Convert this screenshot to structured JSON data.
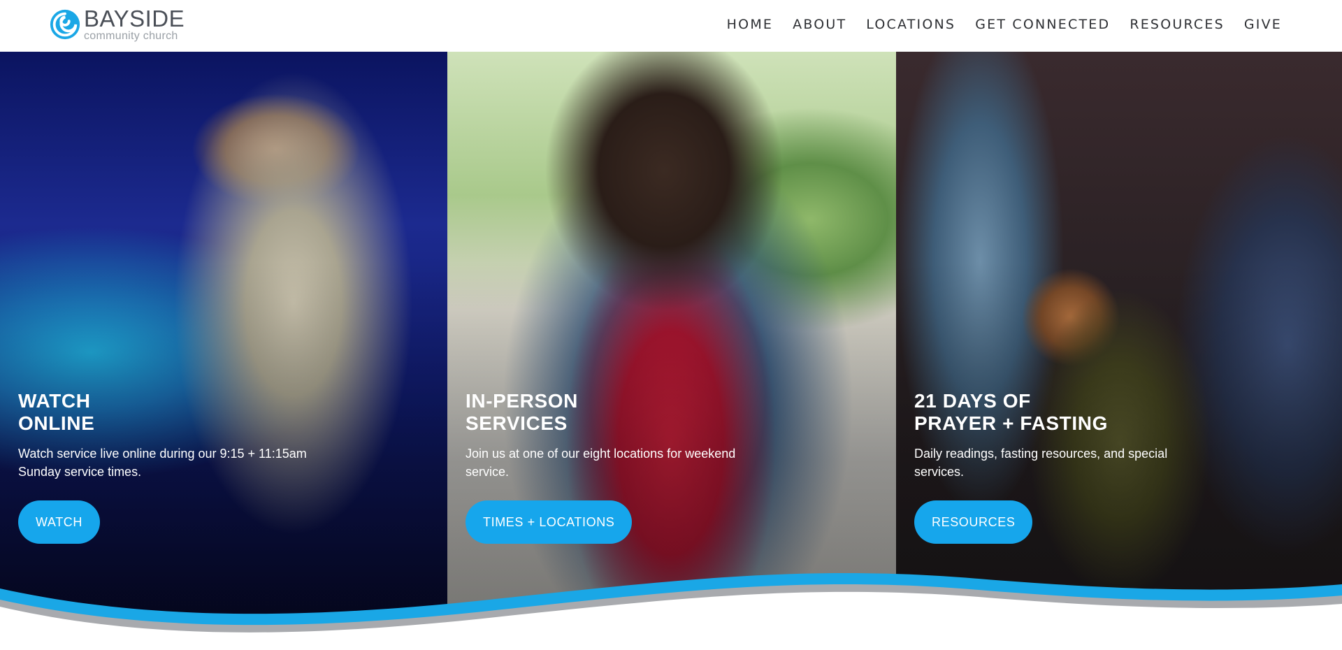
{
  "brand": {
    "name": "BAYSIDE",
    "tagline": "community church",
    "accent_color": "#16a6ec",
    "logo_icon": "swirl-logo-icon"
  },
  "nav": {
    "items": [
      {
        "label": "HOME"
      },
      {
        "label": "ABOUT"
      },
      {
        "label": "LOCATIONS"
      },
      {
        "label": "GET CONNECTED"
      },
      {
        "label": "RESOURCES"
      },
      {
        "label": "GIVE"
      }
    ]
  },
  "panels": [
    {
      "title_line1": "WATCH",
      "title_line2": "ONLINE",
      "description": "Watch service live online during our 9:15 + 11:15am Sunday service times.",
      "button_label": "WATCH"
    },
    {
      "title_line1": "IN-PERSON",
      "title_line2": "SERVICES",
      "description": "Join us at one of our eight locations for weekend service.",
      "button_label": "TIMES + LOCATIONS"
    },
    {
      "title_line1": "21 DAYS OF",
      "title_line2": "PRAYER + FASTING",
      "description": "Daily readings, fasting resources, and special services.",
      "button_label": "RESOURCES"
    }
  ]
}
